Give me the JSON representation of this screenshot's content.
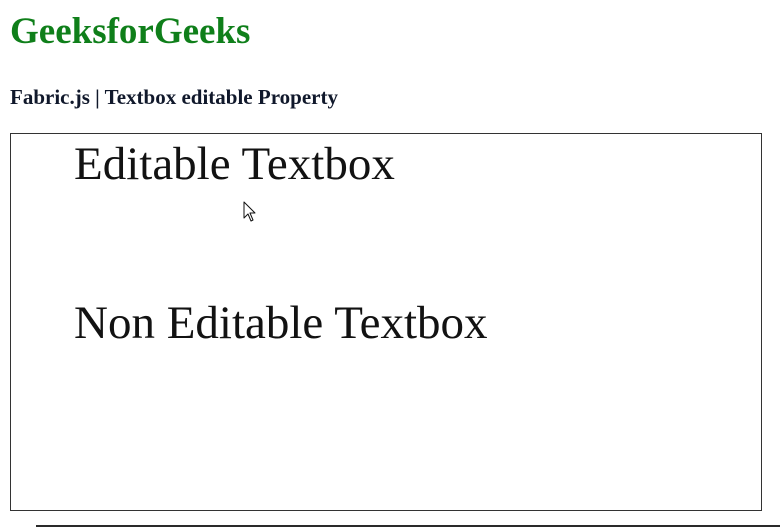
{
  "header": {
    "site_title": "GeeksforGeeks",
    "subtitle": "Fabric.js | Textbox editable Property"
  },
  "canvas": {
    "textboxes": [
      {
        "text": "Editable Textbox",
        "editable": true
      },
      {
        "text": "Non Editable Textbox",
        "editable": false
      }
    ]
  },
  "colors": {
    "title": "#0f7f1a",
    "subtitle": "#10182b",
    "text": "#121212",
    "border": "#333333"
  },
  "icons": {
    "cursor": "mouse-pointer-icon"
  }
}
